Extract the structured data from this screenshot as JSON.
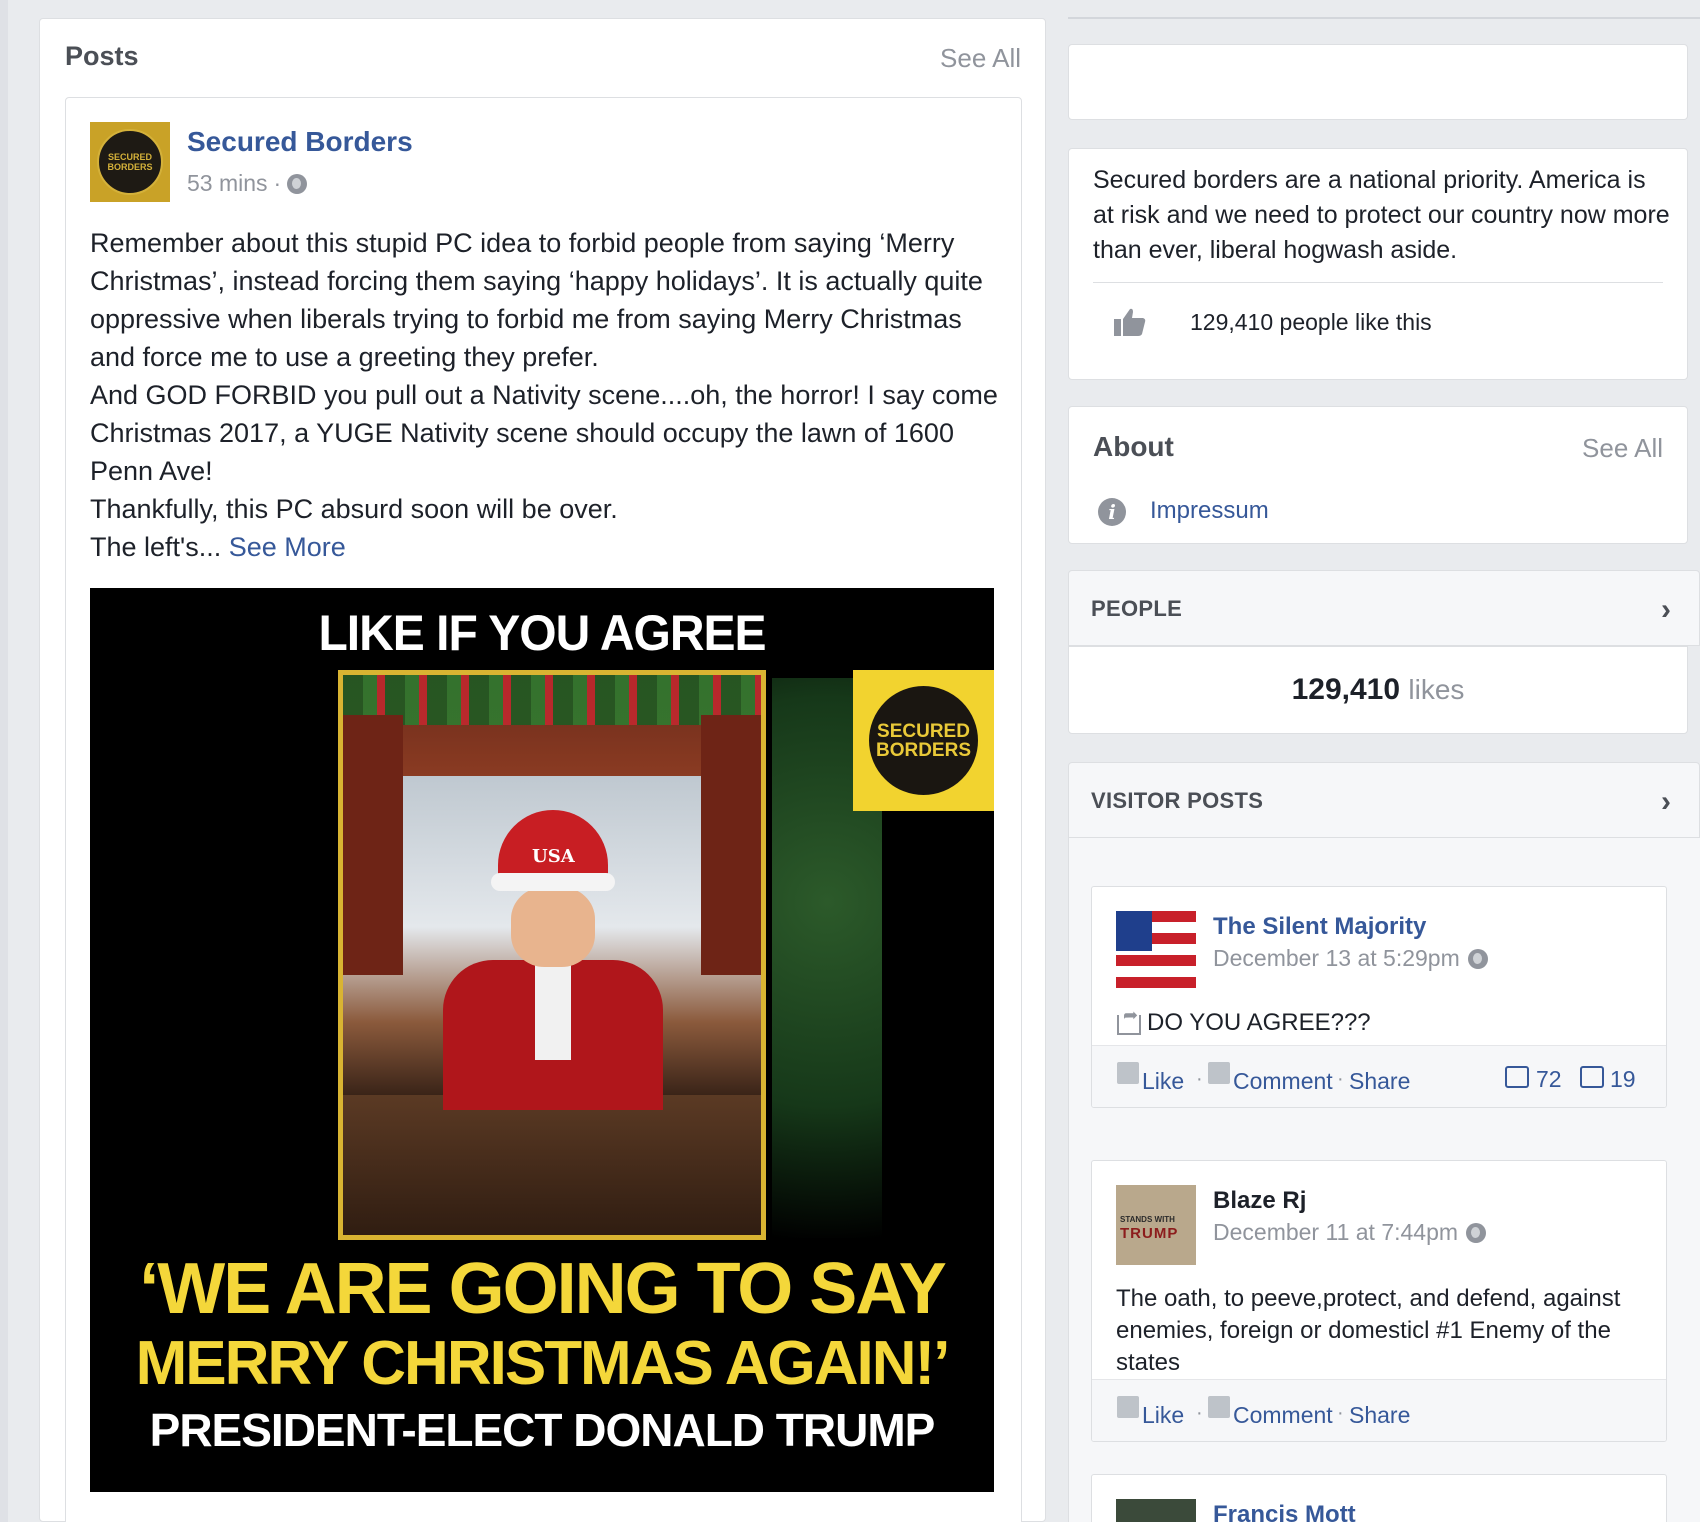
{
  "posts_section": {
    "title": "Posts",
    "see_all": "See All"
  },
  "post": {
    "author": "Secured Borders",
    "avatar_text": "SECURED BORDERS",
    "time": "53 mins",
    "separator": "·",
    "privacy_icon": "globe-icon",
    "paragraphs": [
      "Remember about this stupid PC idea to forbid people from saying ‘Merry Christmas’, instead forcing them saying ‘happy holidays’. It is actually quite oppressive when liberals trying to forbid me from saying Merry Christmas and force me to use a greeting they prefer.",
      "And GOD FORBID you pull out a Nativity scene....oh, the horror! I say come Christmas 2017, a YUGE Nativity scene should occupy the lawn of 1600 Penn Ave!",
      "Thankfully, this PC absurd soon will be over."
    ],
    "truncated_line": "The left's...",
    "see_more": "See More",
    "image": {
      "top_text": "LIKE IF YOU AGREE",
      "badge_text": "SECURED BORDERS",
      "hat_text": "USA",
      "quote_line1": "‘WE ARE GOING TO SAY",
      "quote_line2": "MERRY CHRISTMAS AGAIN!’",
      "caption": "PRESIDENT-ELECT DONALD TRUMP"
    }
  },
  "page_about": {
    "description": "Secured borders are a national priority. America is at risk and we need to protect our country now more than ever, liberal hogwash aside.",
    "likes_text": "129,410 people like this"
  },
  "about": {
    "title": "About",
    "see_all": "See All",
    "impressum": "Impressum"
  },
  "people": {
    "label": "PEOPLE",
    "count": "129,410",
    "unit": "likes"
  },
  "visitor_posts": {
    "label": "VISITOR POSTS",
    "items": [
      {
        "author": "The Silent Majority",
        "date": "December 13 at 5:29pm",
        "text": "DO YOU AGREE???",
        "like": "Like",
        "comment": "Comment",
        "share": "Share",
        "likes_count": "72",
        "comments_count": "19"
      },
      {
        "author": "Blaze Rj",
        "date": "December 11 at 7:44pm",
        "text": "The oath, to peeve,protect, and defend, against enemies, foreign or domesticl #1 Enemy of the states",
        "like": "Like",
        "comment": "Comment",
        "share": "Share"
      },
      {
        "author": "Francis Mott"
      }
    ]
  },
  "colors": {
    "link_blue": "#365899",
    "page_bg": "#e9ebee",
    "meta_gray": "#90949c",
    "image_yellow": "#f4d73a"
  }
}
